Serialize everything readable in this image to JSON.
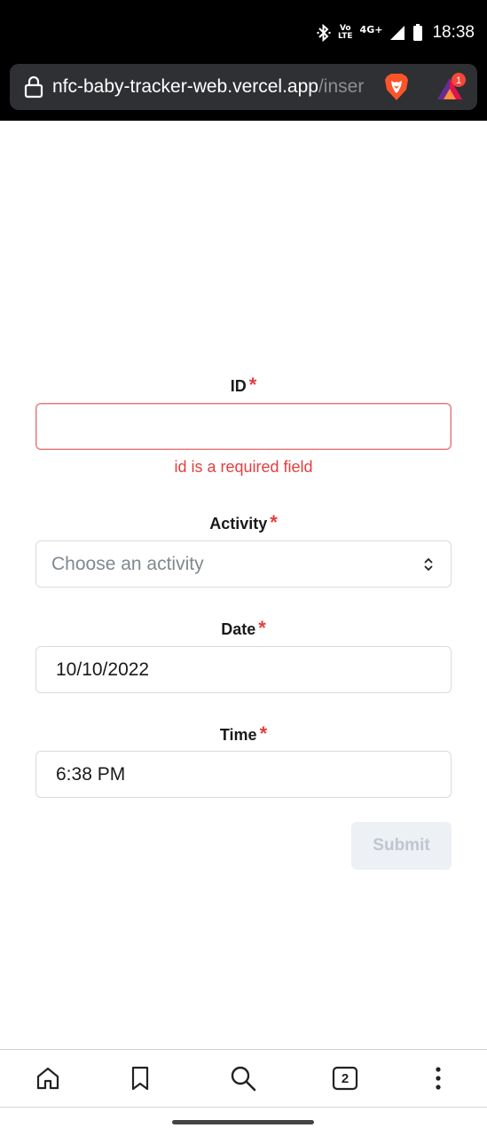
{
  "status_bar": {
    "time": "18:38",
    "network": "4G+",
    "volte_line1": "Vo",
    "volte_line2": "LTE",
    "icons": [
      "bluetooth-icon",
      "volte-icon",
      "signal-icon",
      "battery-icon"
    ]
  },
  "browser": {
    "url_host": "nfc-baby-tracker-web.vercel.app",
    "url_path": "/inser",
    "rewards_badge": "1",
    "icons": [
      "lock-icon",
      "brave-shield-icon",
      "brave-rewards-icon"
    ]
  },
  "form": {
    "id_label": "ID",
    "id_value": "",
    "id_error": "id is a required field",
    "activity_label": "Activity",
    "activity_placeholder": "Choose an activity",
    "date_label": "Date",
    "date_value": "10/10/2022",
    "time_label": "Time",
    "time_value": "6:38 PM",
    "required_marker": "*",
    "submit_label": "Submit"
  },
  "toolbar": {
    "tab_count": "2",
    "icons": [
      "home-icon",
      "bookmark-icon",
      "search-icon",
      "tabs-icon",
      "more-icon"
    ]
  },
  "colors": {
    "error": "#e53e3e",
    "status_bar_bg": "#000000",
    "url_box_bg": "#2f3033",
    "submit_disabled_bg": "#edf0f4",
    "submit_disabled_text": "#c0c6cf"
  }
}
